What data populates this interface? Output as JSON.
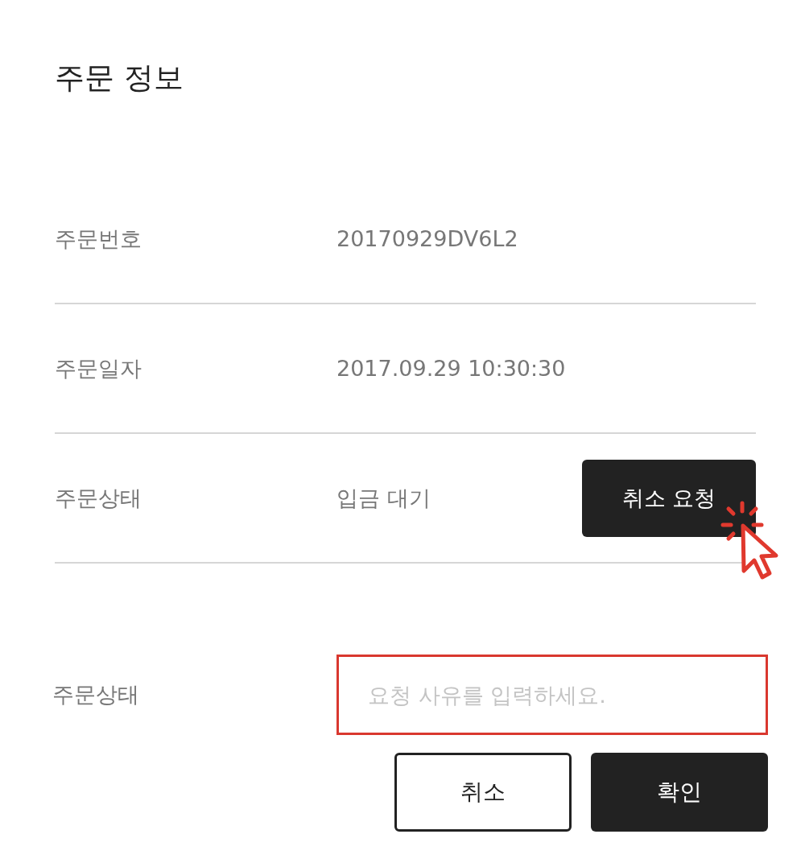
{
  "title": "주문 정보",
  "rows": [
    {
      "label": "주문번호",
      "value": "20170929DV6L2"
    },
    {
      "label": "주문일자",
      "value": "2017.09.29 10:30:30"
    },
    {
      "label": "주문상태",
      "value": "입금 대기",
      "action": {
        "label": "취소 요청",
        "clicked": true
      }
    }
  ],
  "request": {
    "label": "주문상태",
    "placeholder": "요청 사유를 입력하세요.",
    "highlighted": true
  },
  "buttons": [
    {
      "label": "취소",
      "kind": "outline"
    },
    {
      "label": "확인",
      "kind": "filled"
    }
  ]
}
